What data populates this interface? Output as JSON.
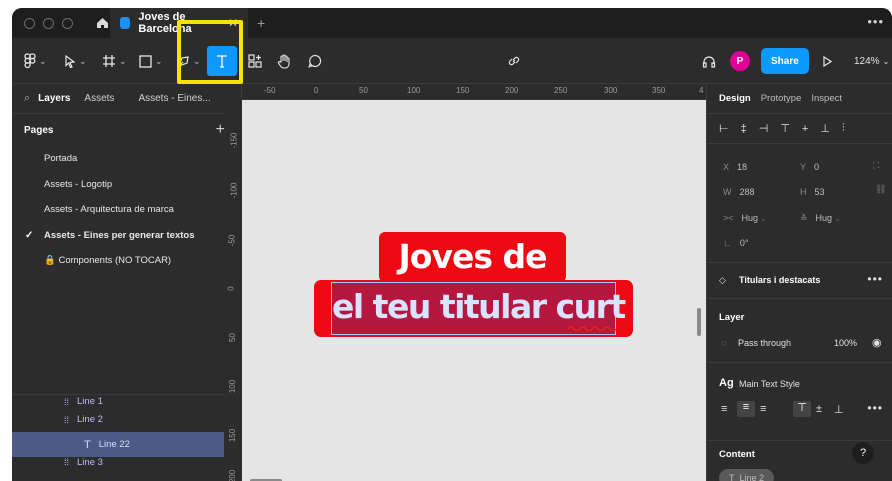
{
  "tab": {
    "title": "Joves de Barcelona",
    "close": "✕"
  },
  "toolbar": {
    "zoom": "124%",
    "share": "Share",
    "avatar": "P"
  },
  "left": {
    "tabs": {
      "layers": "Layers",
      "assets": "Assets",
      "page": "Assets - Eines..."
    },
    "pages_title": "Pages",
    "pages": [
      "Portada",
      "Assets - Logotip",
      "Assets - Arquitectura de marca",
      "Assets - Eines per generar textos",
      "🔒 Components (NO TOCAR)"
    ],
    "layers": [
      {
        "label": "Line 1"
      },
      {
        "label": "Line 2"
      },
      {
        "label": "Line 22"
      },
      {
        "label": "Line 3"
      }
    ]
  },
  "ruler": {
    "top": [
      "-50",
      "0",
      "50",
      "100",
      "150",
      "200",
      "250",
      "300",
      "350",
      "4"
    ],
    "left": [
      "-150",
      "-100",
      "-50",
      "0",
      "50",
      "100",
      "150",
      "200"
    ]
  },
  "canvas": {
    "line1": "Joves de",
    "line2": "el teu titular curt"
  },
  "right": {
    "tabs": [
      "Design",
      "Prototype",
      "Inspect"
    ],
    "x": {
      "label": "X",
      "value": "18"
    },
    "y": {
      "label": "Y",
      "value": "0"
    },
    "w": {
      "label": "W",
      "value": "288"
    },
    "h": {
      "label": "H",
      "value": "53"
    },
    "hug1": "Hug",
    "hug2": "Hug",
    "rotation": "0°",
    "component": "Titulars i destacats",
    "layer_title": "Layer",
    "blend": "Pass through",
    "opacity": "100%",
    "text_style": "Main Text Style",
    "content_title": "Content",
    "content_pill": "Line 2",
    "help": "?"
  }
}
